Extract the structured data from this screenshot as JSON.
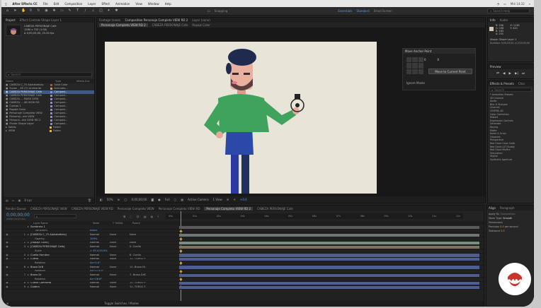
{
  "menubar": {
    "app_name": "After Effects CC",
    "items": [
      "File",
      "Edit",
      "Composition",
      "Layer",
      "Effect",
      "Animation",
      "View",
      "Window",
      "Help"
    ],
    "doc_title": "Adobe After Effects CC 2017 - /Users/UserName/Documents/Projects/Cabeza.aep *",
    "right_items": [
      "Mié 14:32",
      "Search Help"
    ]
  },
  "toolbar": {
    "tools": [
      "home",
      "arrow",
      "hand",
      "zoom",
      "rotate",
      "camera",
      "pan",
      "rect",
      "pen",
      "type",
      "brush",
      "stamp",
      "eraser",
      "roto",
      "puppet"
    ],
    "snapping_label": "Snapping",
    "workspace_items": [
      "Essentials",
      "Standard",
      "Small Screen"
    ],
    "search_placeholder": "Search Help"
  },
  "project_panel": {
    "tabs": [
      "Project",
      "Effect Controls Shape Layer 1"
    ],
    "selected_name": "CABEZA PERSONAJE Cafe",
    "selected_info": [
      "1280 x 720 (1.00)",
      "Δ 0;00;05;00, 25.00 fps"
    ],
    "search_placeholder": "Search",
    "columns": [
      "Name",
      "Type",
      "Media Dur."
    ],
    "items": [
      {
        "name": "CABEZA C_75 Alphabetizio",
        "type": "Solid Color",
        "color": "#b84d4d"
      },
      {
        "name": "Suzan _ 60 (O) Animante",
        "type": "Animatio...",
        "color": "#c9a349"
      },
      {
        "name": "CABEZA PERSONAJE Cafe",
        "type": "Composi...",
        "color": "#8b8bd1",
        "selected": true
      },
      {
        "name": "CABEZA PERSONAJE Cafe",
        "type": "Composi...",
        "color": "#8b8bd1"
      },
      {
        "name": "CABEZA ... MASK VIEW",
        "type": "Composi...",
        "color": "#8b8bd1"
      },
      {
        "name": "CABEZA ... AB VIEW RD",
        "type": "Composi...",
        "color": "#8b8bd1"
      },
      {
        "name": "Cuerpo 1",
        "type": "Composi...",
        "color": "#8b8bd1"
      },
      {
        "name": "Ropaje Color",
        "type": "Composi...",
        "color": "#8b8bd1"
      },
      {
        "name": "Personaje Completo VIEW",
        "type": "Composi...",
        "color": "#8b8bd1"
      },
      {
        "name": "Personaj...ete VIEW",
        "type": "Composi...",
        "color": "#8b8bd1"
      },
      {
        "name": "Persona...ete VIEW RD 2",
        "type": "Composi...",
        "color": "#8b8bd1"
      },
      {
        "name": "Pivote Shape Layer",
        "type": "Composi...",
        "color": "#8b8bd1"
      },
      {
        "name": "Solids",
        "type": "Folder",
        "color": "#d8b85b"
      },
      {
        "name": "VIEW",
        "type": "Folder",
        "color": "#d8b85b"
      }
    ],
    "bpc_label": "8 bpc"
  },
  "composition_panel": {
    "tabs": [
      "Footage (none)",
      "Composition Personaje Completo VIEW RD 2",
      "Layer (none)"
    ],
    "sub_tabs": [
      "Personaje Completo VIEW RD 2",
      "CABEZA PERSONAJE Cafe",
      "Ropaje Color"
    ],
    "zoom": "50%",
    "timecode": "0;00;00;00",
    "resolution": "Full",
    "camera": "Active Camera",
    "views": "1 View",
    "exposure": "+0.0"
  },
  "anchor_popup": {
    "title": "Move Anchor Point",
    "x_value": "0",
    "y_value": "0",
    "move_button": "Move to Current Point",
    "ignore_label": "Ignore Masks"
  },
  "info_panel": {
    "tabs": [
      "Info",
      "Audio"
    ],
    "values": [
      "R: 206",
      "G: 198",
      "B: 183",
      "A: 255"
    ],
    "coords": [
      "X: 1138",
      "Y: 420"
    ],
    "layer_text": "Shape: Shape Layer 1",
    "duration_text": "Duration: 0;00;05;00, Δ 0;00;05;00"
  },
  "preview_panel": {
    "title": "Preview"
  },
  "effects_panel": {
    "title": "Effects & Presets",
    "second_tab": "Char",
    "search_placeholder": "Search",
    "items": [
      "* Animation Presets",
      "3D Channel",
      "Audio",
      "Blur & Sharpen",
      "Channel",
      "CINEMA 4D",
      "Color Correction",
      "Distort",
      "Expression Controls",
      "Generate",
      "Keying",
      "Matte",
      "Noise & Grain",
      "Obsolete",
      "Perspective",
      "Red Giant Color Suite",
      "Red Giant LUT Buddy",
      "Red Giant MisFire",
      "Simulation",
      "Stylize",
      "Synthetic Aperture"
    ]
  },
  "timeline": {
    "tabs": [
      "Render Queue",
      "CABEZA PERSONAJE VIEW",
      "CABEZA PERSONAJE VIEW RD",
      "Personaje Completo VIEW",
      "Personaje Completo VIEW RD",
      "Personaje Completo VIEW RD 2",
      "CABEZA PERSONAJE Cafe"
    ],
    "active_tab_index": 5,
    "timecode": "0;00;00;00",
    "frame_info": "00000 (29.97 fps)",
    "columns": [
      "Layer Name",
      "Mode",
      "T TrkMat",
      "Parent"
    ],
    "ruler": [
      "00s",
      "01s",
      "02s",
      "03s",
      "04s",
      "05s",
      "06s",
      "07s",
      "08s",
      "09s",
      "10s",
      "11s",
      "12s"
    ],
    "layers": [
      {
        "num": "",
        "name": "Sombrero 1",
        "mode": "",
        "trk": "",
        "parent": "",
        "indent": 0,
        "bar": "#5b5b5b"
      },
      {
        "num": "",
        "name": "Transform",
        "mode": "Reset",
        "trk": "",
        "parent": "",
        "indent": 1,
        "bar": ""
      },
      {
        "num": "1",
        "name": "[CABEZA C_75 Alphabetizio]",
        "mode": "Normal",
        "trk": "None",
        "parent": "None",
        "indent": 0,
        "bar": "#6f7878"
      },
      {
        "num": "",
        "name": "Opacity",
        "mode": "100%",
        "trk": "",
        "parent": "",
        "indent": 1,
        "bar": ""
      },
      {
        "num": "2",
        "name": "[Ropaje Color]",
        "mode": "Normal",
        "trk": "None",
        "parent": "None",
        "indent": 0,
        "bar": "#7b8c80"
      },
      {
        "num": "3",
        "name": "[CABEZA PERSONAJE Cafe]",
        "mode": "Normal",
        "trk": "None",
        "parent": "5. Cuello",
        "indent": 0,
        "bar": "#7e7560"
      },
      {
        "num": "",
        "name": "Scale",
        "mode": "∞ 55.0,55.0%",
        "trk": "",
        "parent": "",
        "indent": 1,
        "bar": ""
      },
      {
        "num": "4",
        "name": "Cuello Hombro",
        "mode": "Normal",
        "trk": "None",
        "parent": "6. Cuello",
        "indent": 0,
        "bar": "#4e5e94"
      },
      {
        "num": "5",
        "name": "Cuello",
        "mode": "Normal",
        "trk": "None",
        "parent": "11. TORSO F",
        "indent": 0,
        "bar": "#4e5e94"
      },
      {
        "num": "",
        "name": "Rotation",
        "mode": "0x+0.0°",
        "trk": "",
        "parent": "",
        "indent": 1,
        "bar": ""
      },
      {
        "num": "6",
        "name": "Brazo DrB",
        "mode": "Normal",
        "trk": "None",
        "parent": "11. Brazo Dr",
        "indent": 0,
        "bar": "#4e5e94"
      },
      {
        "num": "",
        "name": "Rotation",
        "mode": "0x+173.9°",
        "trk": "",
        "parent": "",
        "indent": 1,
        "bar": ""
      },
      {
        "num": "7",
        "name": "Brazo Dr",
        "mode": "Normal",
        "trk": "None",
        "parent": "7. Brazo DrB",
        "indent": 0,
        "bar": "#4e5e94"
      },
      {
        "num": "",
        "name": "Rotation",
        "mode": "0x+28.6°",
        "trk": "",
        "parent": "",
        "indent": 1,
        "bar": ""
      },
      {
        "num": "8",
        "name": "Cuello Camiseta",
        "mode": "Normal",
        "trk": "None",
        "parent": "11. TORSO F",
        "indent": 0,
        "bar": "#4e5e94"
      },
      {
        "num": "9",
        "name": "Cadera",
        "mode": "Normal",
        "trk": "None",
        "parent": "11. TORSO F",
        "indent": 0,
        "bar": "#4e5e94"
      }
    ],
    "footer_label": "Toggle Switches / Modes"
  },
  "paragraph_panel": {
    "tabs": [
      "Align",
      "Paragraph"
    ],
    "apply_label": "Apply To:",
    "apply_value": "Composition",
    "mode_label": "Move Type:",
    "mode_value": "Smooth",
    "dims_label": "Dimensions",
    "precision_label": "Precision",
    "precision_value": "0.0",
    "unit_label": "per second",
    "tolerance_label": "Tolerance",
    "tolerance_value": "0.5"
  },
  "colors": {
    "canvas_bg": "#e9e4d8",
    "selection": "#3f5b85",
    "accent_blue": "#5b9ae0",
    "keyframe_orange": "#d8a23a",
    "logo_red": "#c8362b"
  }
}
